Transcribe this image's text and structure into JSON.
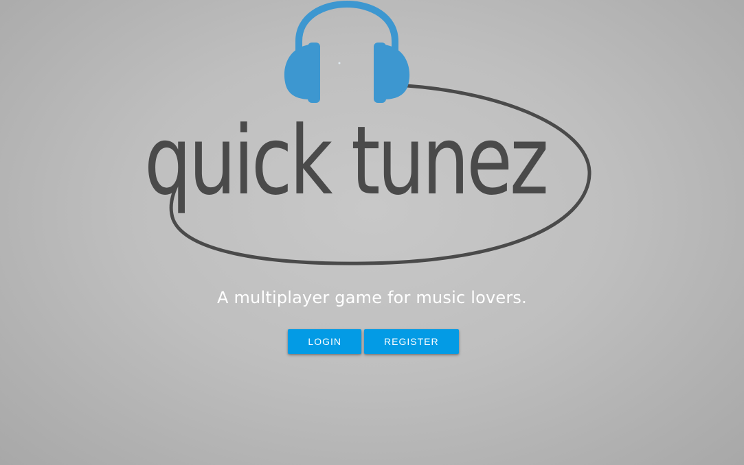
{
  "logo": {
    "text": "quick tunez",
    "icon": "headphones-icon",
    "headphone_color": "#3d97d0",
    "text_color": "#4a4a4a"
  },
  "tagline": "A multiplayer game for music lovers.",
  "buttons": {
    "login_label": "LOGIN",
    "register_label": "REGISTER",
    "color": "#039be5"
  }
}
